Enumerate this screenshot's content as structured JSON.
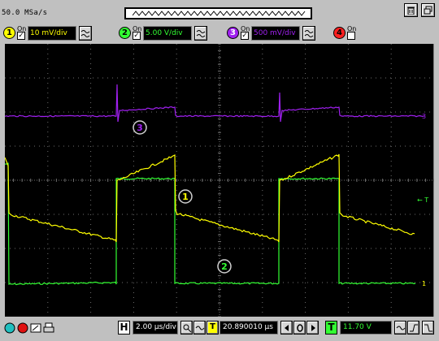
{
  "header": {
    "sample_rate": "50.0 MSa/s"
  },
  "channels": [
    {
      "number": "1",
      "on_label": "On",
      "checked": "✓",
      "scale": "10 mV/div",
      "color": "#ffff00"
    },
    {
      "number": "2",
      "on_label": "On",
      "checked": "✓",
      "scale": "5.00 V/div",
      "color": "#33ff33"
    },
    {
      "number": "3",
      "on_label": "On",
      "checked": "✓",
      "scale": "500 mV/div",
      "color": "#a020f0"
    },
    {
      "number": "4",
      "on_label": "On",
      "checked": "",
      "scale": "",
      "color": "#ff2020"
    }
  ],
  "display": {
    "trace_labels": {
      "ch1": "1",
      "ch2": "2",
      "ch3": "3"
    },
    "right_markers": {
      "ch3": "3",
      "trigger": "← T",
      "ch12": "1"
    },
    "left_marker": "T",
    "colors": {
      "grid": "#6e6e6e",
      "ch1": "#ffff00",
      "ch2": "#33ff33",
      "ch3": "#a020f0"
    }
  },
  "bottom": {
    "timebase_letter": "H",
    "timebase": "2.00 µs/div",
    "delay_letter": "T",
    "delay": "20.890010 µs",
    "trigger_letter": "T",
    "trigger_level": "11.70 V",
    "trigger_color": "#33ff33"
  }
}
